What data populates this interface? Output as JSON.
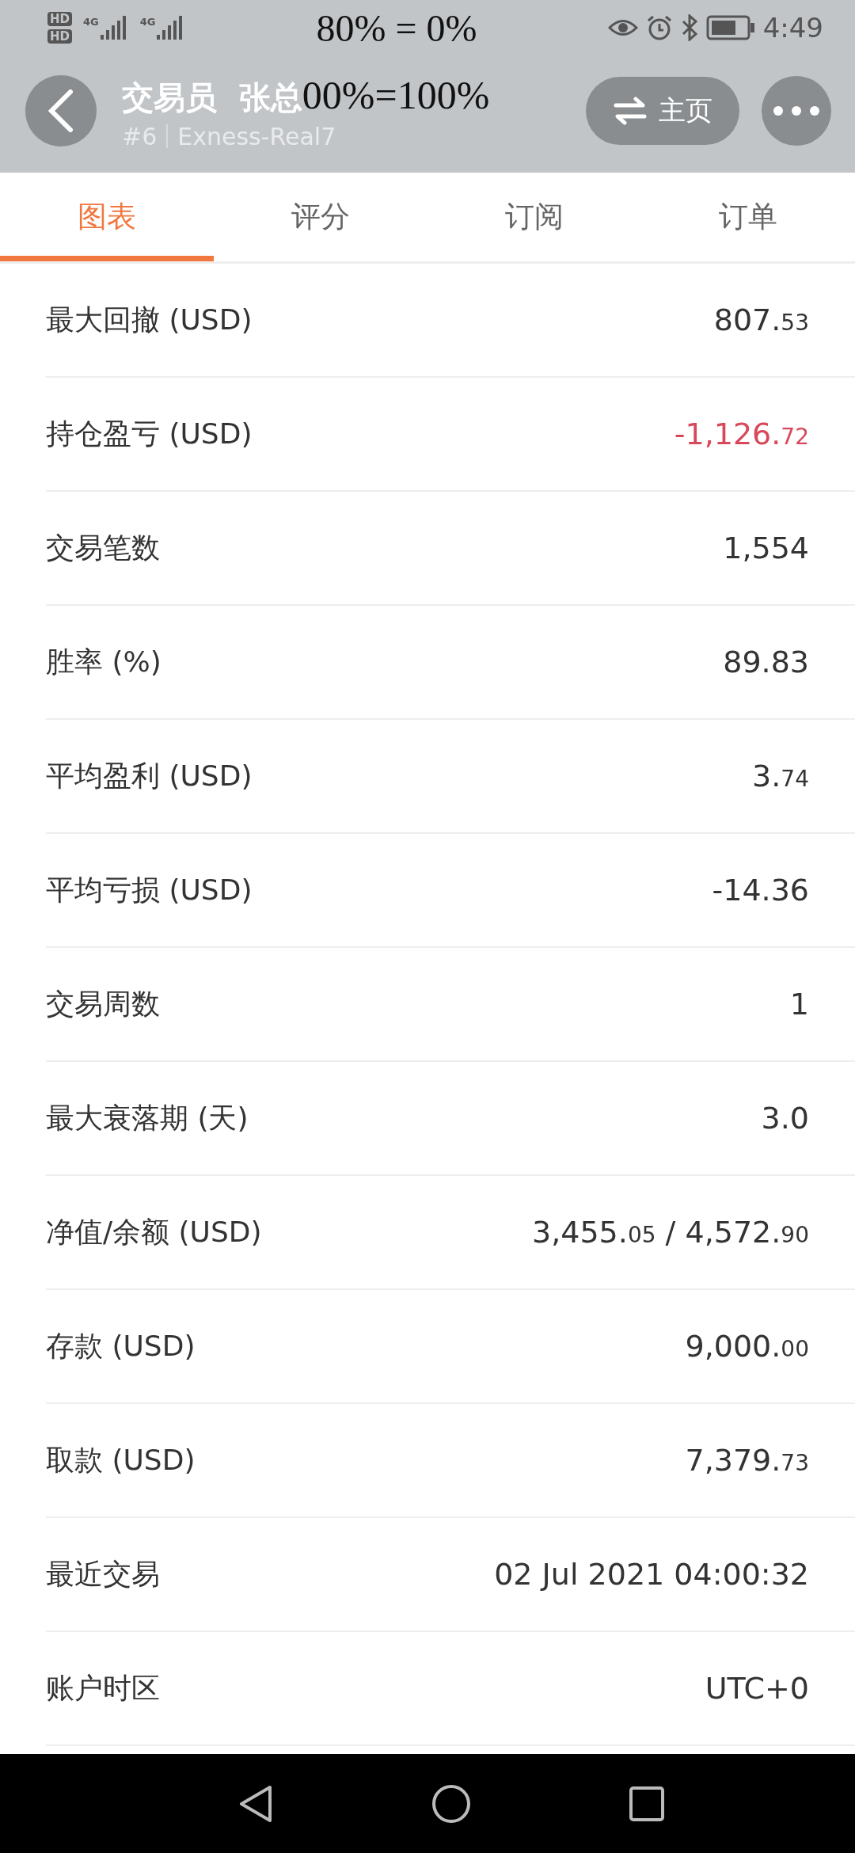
{
  "status_bar": {
    "time": "4:49",
    "sim_labels": [
      "HD",
      "HD"
    ],
    "network_labels": [
      "4G",
      "4G"
    ]
  },
  "overlay_notes": [
    "80% = 0%",
    "00%=100%"
  ],
  "header": {
    "title": "交易员  张总",
    "rank": "#6",
    "account": "Exness-Real7",
    "home_button": "主页"
  },
  "tabs": [
    {
      "label": "图表",
      "selected": true
    },
    {
      "label": "评分",
      "selected": false
    },
    {
      "label": "订阅",
      "selected": false
    },
    {
      "label": "订单",
      "selected": false
    }
  ],
  "rows": [
    {
      "label": "最大回撤 (USD)",
      "value": "807.53",
      "small_decimals": true,
      "negative": false
    },
    {
      "label": "持仓盈亏 (USD)",
      "value": "-1,126.72",
      "small_decimals": true,
      "negative": true
    },
    {
      "label": "交易笔数",
      "value": "1,554",
      "negative": false
    },
    {
      "label": "胜率 (%)",
      "value": "89.83",
      "small_decimals": false,
      "negative": false
    },
    {
      "label": "平均盈利 (USD)",
      "value": "3.74",
      "small_decimals": true,
      "negative": false
    },
    {
      "label": "平均亏损 (USD)",
      "value": "-14.36",
      "small_decimals": false,
      "negative": false
    },
    {
      "label": "交易周数",
      "value": "1",
      "negative": false
    },
    {
      "label": "最大衰落期 (天)",
      "value": "3.0",
      "small_decimals": false,
      "negative": false
    },
    {
      "label": "净值/余额 (USD)",
      "value": "3,455.05 / 4,572.90",
      "small_decimals": true,
      "negative": false
    },
    {
      "label": "存款 (USD)",
      "value": "9,000.00",
      "small_decimals": true,
      "negative": false
    },
    {
      "label": "取款 (USD)",
      "value": "7,379.73",
      "small_decimals": true,
      "negative": false
    },
    {
      "label": "最近交易",
      "value": "02 Jul 2021 04:00:32",
      "negative": false
    },
    {
      "label": "账户时区",
      "value": "UTC+0",
      "negative": false
    }
  ]
}
